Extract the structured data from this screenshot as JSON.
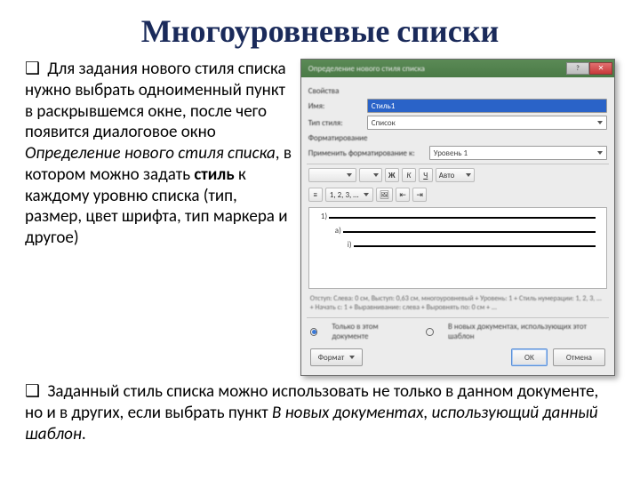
{
  "title": "Многоуровневые списки",
  "para1": {
    "bullet": "❑",
    "pre": " Для задания нового стиля списка нужно выбрать одноименный пункт в раскрывшемся окне, после чего появится диалоговое окно ",
    "italic": "Определение нового стиля списка",
    "mid": ", в котором можно задать ",
    "bold": "стиль",
    "post": " к каждому уровню списка (тип, размер, цвет шрифта, тип маркера и другое)"
  },
  "para2": {
    "bullet": "❑",
    "pre": " Заданный стиль списка можно использовать не только в данном документе, но и в других, если выбрать пункт ",
    "italic": "В новых документах, использующий данный шаблон",
    "post": "."
  },
  "dialog": {
    "title": "Определение нового стиля списка",
    "win": {
      "help": "?",
      "close": "✕"
    },
    "section_props": "Свойства",
    "name_label": "Имя:",
    "name_value": "Стиль1",
    "type_label": "Тип стиля:",
    "type_value": "Список",
    "section_format": "Форматирование",
    "apply_label": "Применить форматирование к:",
    "apply_value": "Уровень 1",
    "font_name": "",
    "font_size": "",
    "bold": "Ж",
    "italic": "К",
    "underline": "Ч",
    "auto": "Авто",
    "num_style": "1, 2, 3, …",
    "preview_nums": [
      "1)",
      "a)",
      "i)"
    ],
    "desc": "Отступ: Слева: 0 см, Выступ: 0,63 см, многоуровневый + Уровень: 1 + Стиль нумерации: 1, 2, 3, … + Начать с: 1 + Выравнивание: слева + Выровнять по: 0 см + ...",
    "radio_this": "Только в этом документе",
    "radio_new": "В новых документах, использующих этот шаблон",
    "format_btn": "Формат",
    "ok": "ОК",
    "cancel": "Отмена"
  }
}
